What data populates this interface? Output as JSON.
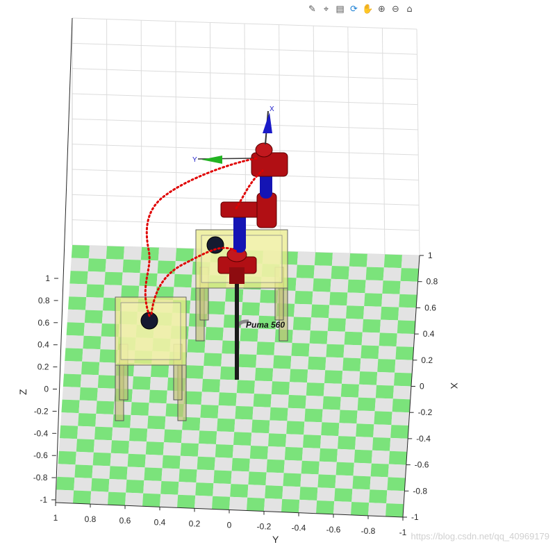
{
  "toolbar": [
    {
      "icon": "brush-icon",
      "glyph": "✎"
    },
    {
      "icon": "data-tips-icon",
      "glyph": "⌖"
    },
    {
      "icon": "legend-icon",
      "glyph": "▤"
    },
    {
      "icon": "rotate-3d-icon",
      "glyph": "⟳"
    },
    {
      "icon": "pan-hand-icon",
      "glyph": "✋"
    },
    {
      "icon": "zoom-in-icon",
      "glyph": "⊕"
    },
    {
      "icon": "zoom-out-icon",
      "glyph": "⊖"
    },
    {
      "icon": "home-icon",
      "glyph": "⌂"
    }
  ],
  "chart_data": {
    "type": "scatter",
    "title": "",
    "robot_name": "Puma 560",
    "frame_labels": {
      "x": "X",
      "y": "Y"
    },
    "xlabel": "X",
    "ylabel": "Y",
    "zlabel": "Z",
    "xlim": [
      -1,
      1
    ],
    "ylim": [
      -1,
      1
    ],
    "zlim": [
      -1,
      1
    ],
    "x_ticks": [
      "1",
      "0.8",
      "0.6",
      "0.4",
      "0.2",
      "0",
      "-0.2",
      "-0.4",
      "-0.6",
      "-0.8",
      "-1"
    ],
    "y_ticks": [
      "1",
      "0.8",
      "0.6",
      "0.4",
      "0.2",
      "0",
      "-0.2",
      "-0.4",
      "-0.6",
      "-0.8",
      "-1"
    ],
    "z_ticks": [
      "1",
      "0.8",
      "0.6",
      "0.4",
      "0.2",
      "0",
      "-0.2",
      "-0.4",
      "-0.6",
      "-0.8",
      "-1"
    ],
    "grid": true,
    "floor": "checkerboard",
    "colors": {
      "trajectory": "#e00000",
      "checker_a": "#7be37b",
      "checker_b": "#e3e3e3",
      "link_red": "#b10f14",
      "link_blue": "#1414b4",
      "table": "#e9eb8a",
      "ball": "#151a30"
    },
    "series": [
      {
        "name": "",
        "points": [
          [
            0.5,
            0.5,
            0.15
          ],
          [
            0.45,
            0.5,
            0.35
          ],
          [
            0.35,
            0.45,
            0.55
          ],
          [
            0.25,
            0.35,
            0.65
          ],
          [
            0.15,
            0.2,
            0.7
          ]
        ]
      },
      {
        "name": "",
        "points": [
          [
            0.5,
            0.5,
            0.15
          ],
          [
            0.5,
            0.4,
            0.25
          ],
          [
            0.55,
            0.25,
            0.3
          ],
          [
            0.6,
            0.1,
            0.3
          ]
        ]
      }
    ]
  },
  "watermark": "https://blog.csdn.net/qq_40969179"
}
